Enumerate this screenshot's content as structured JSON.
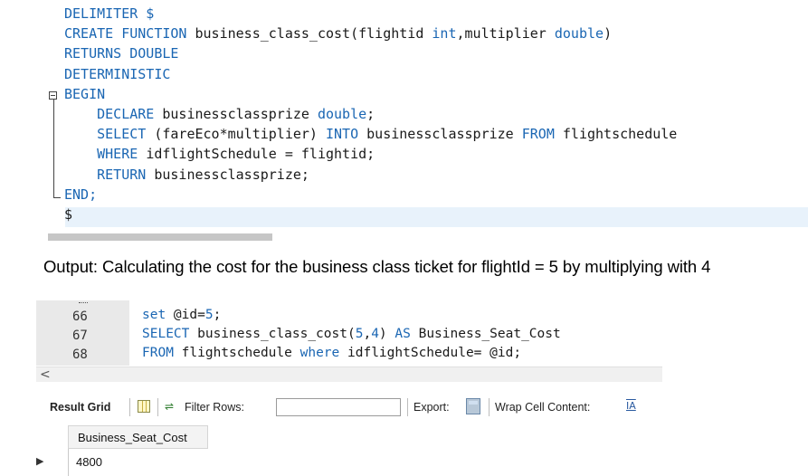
{
  "editor_top": {
    "lines": [
      [
        {
          "t": "DELIMITER $",
          "c": "kw2"
        }
      ],
      [
        {
          "t": "CREATE FUNCTION ",
          "c": "kw"
        },
        {
          "t": "business_class_cost(flightid ",
          "c": ""
        },
        {
          "t": "int",
          "c": "kw"
        },
        {
          "t": ",multiplier ",
          "c": ""
        },
        {
          "t": "double",
          "c": "kw"
        },
        {
          "t": ")",
          "c": ""
        }
      ],
      [
        {
          "t": "RETURNS DOUBLE",
          "c": "kw"
        }
      ],
      [
        {
          "t": "DETERMINISTIC",
          "c": "kw"
        }
      ],
      [
        {
          "t": "BEGIN",
          "c": "kw"
        }
      ],
      [
        {
          "t": "    DECLARE ",
          "c": "kw"
        },
        {
          "t": "businessclassprize ",
          "c": ""
        },
        {
          "t": "double",
          "c": "kw"
        },
        {
          "t": ";",
          "c": ""
        }
      ],
      [
        {
          "t": "    SELECT ",
          "c": "kw"
        },
        {
          "t": "(fareEco*multiplier) ",
          "c": ""
        },
        {
          "t": "INTO ",
          "c": "kw"
        },
        {
          "t": "businessclassprize ",
          "c": ""
        },
        {
          "t": "FROM ",
          "c": "kw"
        },
        {
          "t": "flightschedule",
          "c": ""
        }
      ],
      [
        {
          "t": "    WHERE ",
          "c": "kw"
        },
        {
          "t": "idflightSchedule = flightid;",
          "c": ""
        }
      ],
      [
        {
          "t": "    RETURN ",
          "c": "kw"
        },
        {
          "t": "businessclassprize;",
          "c": ""
        }
      ],
      [
        {
          "t": "END;",
          "c": "kw"
        }
      ],
      [
        {
          "t": "$",
          "c": ""
        }
      ]
    ]
  },
  "caption": "Output: Calculating the cost for the business class ticket for flightId = 5 by multiplying with 4",
  "editor_bottom": {
    "line_numbers": [
      "66",
      "67",
      "68"
    ],
    "lines": [
      [
        {
          "t": "set ",
          "c": "kw"
        },
        {
          "t": "@id=",
          "c": ""
        },
        {
          "t": "5",
          "c": "kw"
        },
        {
          "t": ";",
          "c": ""
        }
      ],
      [
        {
          "t": "SELECT ",
          "c": "kw"
        },
        {
          "t": "business_class_cost(",
          "c": ""
        },
        {
          "t": "5",
          "c": "kw"
        },
        {
          "t": ",",
          "c": ""
        },
        {
          "t": "4",
          "c": "kw"
        },
        {
          "t": ") ",
          "c": ""
        },
        {
          "t": "AS ",
          "c": "kw"
        },
        {
          "t": "Business_Seat_Cost",
          "c": ""
        }
      ],
      [
        {
          "t": "FROM ",
          "c": "kw"
        },
        {
          "t": "flightschedule ",
          "c": ""
        },
        {
          "t": "where ",
          "c": "kw"
        },
        {
          "t": "idflightSchedule= @id;",
          "c": ""
        }
      ]
    ]
  },
  "toolbar": {
    "result_grid": "Result Grid",
    "filter_rows": "Filter Rows:",
    "export": "Export:",
    "wrap_cell": "Wrap Cell Content:",
    "wrap_icon": "IA"
  },
  "grid": {
    "column": "Business_Seat_Cost",
    "value": "4800",
    "row_marker": "▶"
  },
  "colors": {
    "keyword": "#1a66b3",
    "selection": "#e8f2fb"
  }
}
